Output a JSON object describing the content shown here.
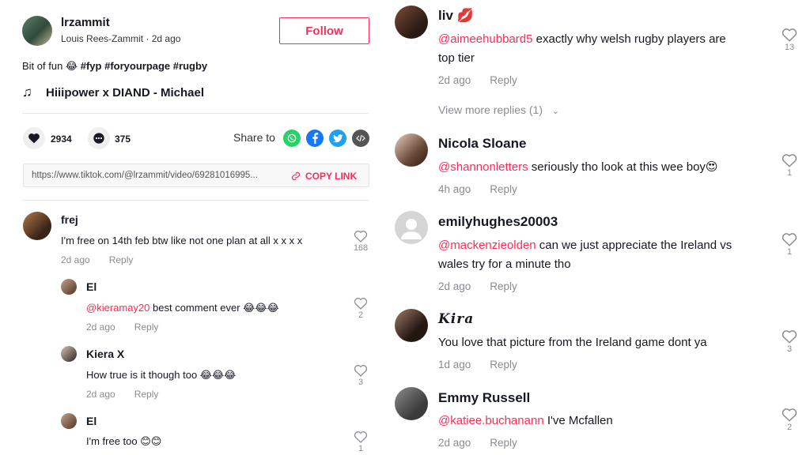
{
  "post": {
    "username": "lrzammit",
    "display_name": "Louis Rees-Zammit",
    "time": "2d ago",
    "follow_label": "Follow",
    "caption_text": "Bit of fun 😂 ",
    "hashtags": [
      "#fyp",
      "#foryourpage",
      "#rugby"
    ],
    "music_icon": "♫",
    "music": "Hiiipower x DIAND - Michael",
    "likes": "2934",
    "comments": "375",
    "share_label": "Share to",
    "share_icons": [
      "whatsapp-icon",
      "facebook-icon",
      "twitter-icon",
      "embed-icon"
    ],
    "link_url": "https://www.tiktok.com/@lrzammit/video/69281016995...",
    "copy_label": "COPY LINK"
  },
  "reply_label": "Reply",
  "left_comments": [
    {
      "name": "frej",
      "mention": "",
      "text": "I'm free on 14th feb btw like not one plan at all x x x x",
      "time": "2d ago",
      "likes": "168"
    },
    {
      "name": "El",
      "mention": "@kieramay20",
      "text": " best comment ever 😂😂😂",
      "time": "2d ago",
      "likes": "2"
    },
    {
      "name": "Kiera X",
      "mention": "",
      "text": "How true is it though too 😂😂😂",
      "time": "2d ago",
      "likes": "3"
    },
    {
      "name": "El",
      "mention": "",
      "text": "I'm free too 😊😊",
      "time": "2d ago",
      "likes": "1"
    }
  ],
  "right_comments": [
    {
      "name": "liv 💋",
      "mention": "@aimeehubbard5",
      "text": " exactly why welsh rugby players are",
      "text2": "top tier",
      "time": "2d ago",
      "likes": "13"
    },
    {
      "name": "Nicola Sloane",
      "mention": "@shannonletters",
      "text": " seriously tho look at this wee boy😍",
      "text2": "",
      "time": "4h ago",
      "likes": "1"
    },
    {
      "name": "emilyhughes20003",
      "mention": "@mackenzieolden",
      "text": " can we just appreciate the Ireland vs",
      "text2": "wales try for a minute tho",
      "time": "2d ago",
      "likes": "1"
    },
    {
      "name": "Kira",
      "mention": "",
      "text": "You love that picture from the Ireland game dont ya",
      "text2": "",
      "time": "1d ago",
      "likes": "3"
    },
    {
      "name": "Emmy Russell",
      "mention": "@katiee.buchanann",
      "text": " I've Mcfallen",
      "text2": "",
      "time": "2d ago",
      "likes": "2"
    }
  ],
  "view_more_replies": "View more replies (1)",
  "colors": {
    "accent": "#fe2c55",
    "meta": "#8a8b91",
    "whatsapp": "#25d366",
    "facebook": "#1877f2",
    "twitter": "#1da1f2",
    "embed": "#555555"
  }
}
